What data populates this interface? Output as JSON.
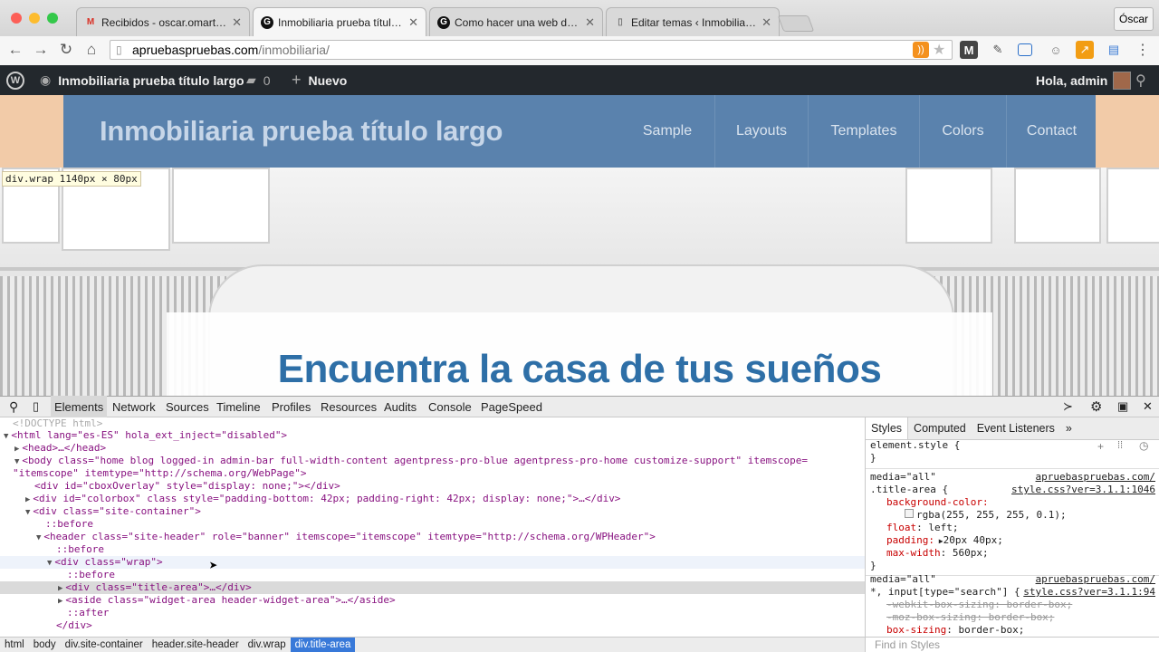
{
  "browser": {
    "tabs": [
      {
        "label": "Recibidos - oscar.omartinez",
        "icon": "gmail-icon",
        "active": false
      },
      {
        "label": "Inmobiliaria prueba título la",
        "icon": "google-icon",
        "active": true
      },
      {
        "label": "Como hacer una web de in",
        "icon": "google-icon",
        "active": false
      },
      {
        "label": "Editar temas ‹ Inmobiliaria",
        "icon": "page-icon",
        "active": false
      }
    ],
    "user_button": "Óscar",
    "url_host": "apruebaspruebas.com",
    "url_path": "/inmobiliaria/"
  },
  "admin_bar": {
    "site_name": "Inmobiliaria prueba título largo",
    "comments_count": "0",
    "new_label": "Nuevo",
    "greeting": "Hola, admin"
  },
  "site": {
    "title": "Inmobiliaria prueba título largo",
    "nav": [
      "Sample",
      "Layouts",
      "Templates",
      "Colors",
      "Contact"
    ],
    "hero_heading": "Encuentra la casa de tus sueños",
    "inspect_tooltip": "div.wrap 1140px × 80px"
  },
  "devtools": {
    "tabs": [
      "Elements",
      "Network",
      "Sources",
      "Timeline",
      "Profiles",
      "Resources",
      "Audits",
      "Console",
      "PageSpeed"
    ],
    "active_tab": "Elements",
    "dom_lines": {
      "doctype": "<!DOCTYPE html>",
      "html_open": "<html lang=\"es-ES\" hola_ext_inject=\"disabled\">",
      "head": "<head>…</head>",
      "body_open": "<body class=\"home blog logged-in admin-bar full-width-content agentpress-pro-blue agentpress-pro-home customize-support\" itemscope=",
      "body_cont": "\"itemscope\" itemtype=\"http://schema.org/WebPage\">",
      "cbox": "<div id=\"cboxOverlay\" style=\"display: none;\"></div>",
      "colorbox": "<div id=\"colorbox\" class style=\"padding-bottom: 42px; padding-right: 42px; display: none;\">…</div>",
      "site_container": "<div class=\"site-container\">",
      "before1": "::before",
      "header": "<header class=\"site-header\" role=\"banner\" itemscope=\"itemscope\" itemtype=\"http://schema.org/WPHeader\">",
      "before2": "::before",
      "wrap": "<div class=\"wrap\">",
      "before3": "::before",
      "title_area": "<div class=\"title-area\">…</div>",
      "aside": "<aside class=\"widget-area header-widget-area\">…</aside>",
      "after": "::after",
      "div_close": "</div>"
    },
    "styles_tabs": [
      "Styles",
      "Computed",
      "Event Listeners"
    ],
    "styles": {
      "element_style": "element.style {",
      "close_brace": "}",
      "rule1_media": "media=\"all\"",
      "rule1_src1": "apruebaspruebas.com/",
      "rule1_src2": "style.css?ver=3.1.1:1046",
      "rule1_selector": ".title-area {",
      "rule1_p1_name": "background-color:",
      "rule1_p1_value": "rgba(255, 255, 255, 0.1);",
      "rule1_p2": "float: left;",
      "rule1_p3_name": "padding:",
      "rule1_p3_value": "20px 40px;",
      "rule1_p4": "max-width: 560px;",
      "rule2_media": "media=\"all\"",
      "rule2_src1": "apruebaspruebas.com/",
      "rule2_src2": "style.css?ver=3.1.1:94",
      "rule2_selector": "*, input[type=\"search\"] {",
      "rule2_p1": "-webkit-box-sizing: border-box;",
      "rule2_p2": "-moz-box-sizing: border-box;",
      "rule2_p3": "box-sizing: border-box;"
    },
    "breadcrumbs": [
      "html",
      "body",
      "div.site-container",
      "header.site-header",
      "div.wrap",
      "div.title-area"
    ],
    "find_placeholder": "Find in Styles"
  }
}
